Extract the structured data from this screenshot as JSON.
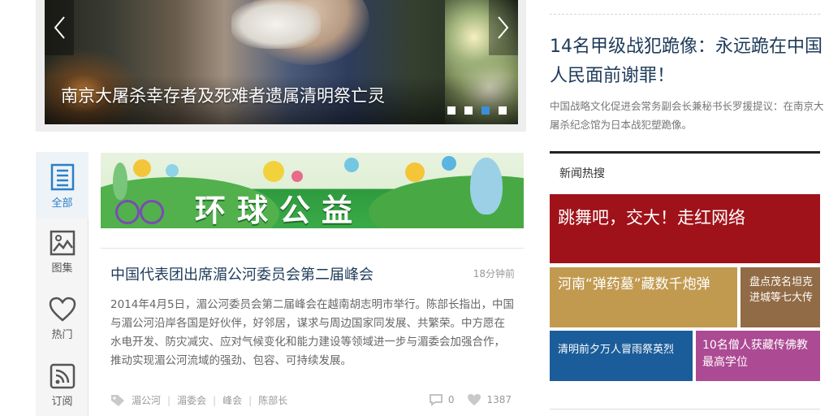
{
  "carousel": {
    "caption": "南京大屠杀幸存者及死难者遗属清明祭亡灵",
    "prev_icon": "chevron-left",
    "next_icon": "chevron-right",
    "dots": 4,
    "active_dot": 3
  },
  "rail": {
    "items": [
      {
        "label": "全部",
        "icon": "list-icon",
        "active": true
      },
      {
        "label": "图集",
        "icon": "image-icon",
        "active": false
      },
      {
        "label": "热门",
        "icon": "heart-icon",
        "active": false
      },
      {
        "label": "订阅",
        "icon": "rss-icon",
        "active": false
      }
    ]
  },
  "banner": {
    "title": "环球公益"
  },
  "article": {
    "title": "中国代表团出席湄公河委员会第二届峰会",
    "time": "18分钟前",
    "body": "2014年4月5日，湄公河委员会第二届峰会在越南胡志明市举行。陈部长指出，中国与湄公河沿岸各国是好伙伴，好邻居，谋求与周边国家同发展、共繁荣。中方愿在水电开发、防灾减灾、应对气候变化和能力建设等领域进一步与湄委会加强合作，推动实现湄公河流域的强劲、包容、可持续发展。",
    "tags": [
      "湄公河",
      "湄委会",
      "峰会",
      "陈部长"
    ],
    "comments": "0",
    "likes": "1387"
  },
  "headline": {
    "title": "14名甲级战犯跪像：永远跪在中国人民面前谢罪！",
    "desc": "中国战略文化促进会常务副会长兼秘书长罗援提议：在南京大屠杀纪念馆为日本战犯塑跪像。"
  },
  "hot": {
    "title": "新闻热搜",
    "tiles": [
      {
        "text": "跳舞吧，交大！走红网络",
        "color": "#a0121a"
      },
      {
        "text": "河南“弹药墓”藏数千炮弹",
        "color": "#c19a50"
      },
      {
        "text": "盘点茂名坦克进城等七大传",
        "color": "#916b45"
      },
      {
        "text": "清明前夕万人冒雨祭英烈",
        "color": "#1b5d9a"
      },
      {
        "text": "10名僧人获藏传佛教最高学位",
        "color": "#ac4a93"
      }
    ]
  }
}
